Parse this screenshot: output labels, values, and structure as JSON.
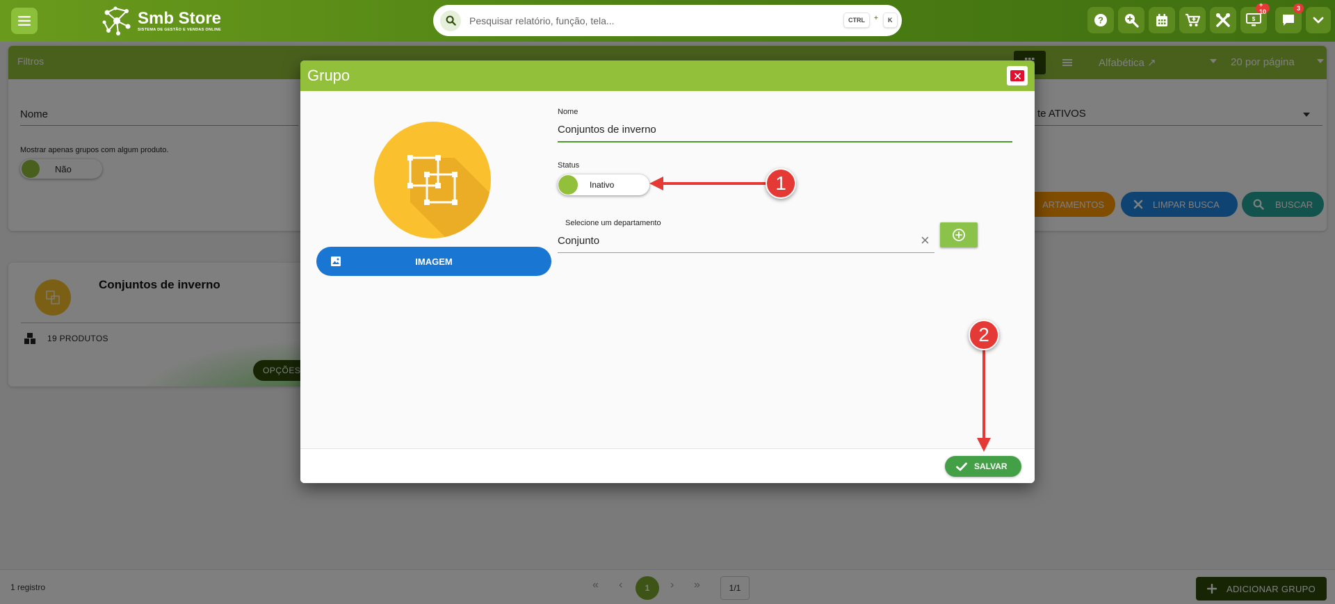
{
  "topbar": {
    "brand_title": "Smb Store",
    "brand_subtitle": "SISTEMA DE GESTÃO E VENDAS ONLINE",
    "search_placeholder": "Pesquisar relatório, função, tela...",
    "shortcut_ctrl": "CTRL",
    "shortcut_plus": "+",
    "shortcut_key": "K",
    "icons": [
      "help-icon",
      "zoom-icon",
      "calendar-icon",
      "cart-icon",
      "tools-icon",
      "monitor-icon",
      "chat-icon",
      "chevron-down-icon"
    ],
    "monitor_badge": "+ 10",
    "chat_badge": "3"
  },
  "filters": {
    "title": "Filtros",
    "sort_label": "Alfabética ↗",
    "per_page_label": "20 por página",
    "name_label": "Nome",
    "status_value": "te ATIVOS",
    "only_with_products_label": "Mostrar apenas grupos com algum produto.",
    "only_with_products_value": "Não",
    "btn_departments": "ARTAMENTOS",
    "btn_clear": "LIMPAR BUSCA",
    "btn_search": "BUSCAR"
  },
  "group_card": {
    "name": "Conjuntos de inverno",
    "product_count": "19 PRODUTOS",
    "options_label": "OPÇÕES"
  },
  "footer": {
    "record_count": "1 registro",
    "first": "«",
    "prev": "‹",
    "current_page": "1",
    "next": "›",
    "last": "»",
    "page_of": "1/1",
    "add_group_label": "ADICIONAR GRUPO"
  },
  "modal": {
    "title": "Grupo",
    "image_button_label": "IMAGEM",
    "name_label": "Nome",
    "name_value": "Conjuntos de inverno",
    "status_label": "Status",
    "status_value": "Inativo",
    "department_label": "Selecione um departamento",
    "department_value": "Conjunto",
    "save_label": "SALVAR"
  },
  "annotations": {
    "marker_1": "1",
    "marker_2": "2"
  },
  "colors": {
    "brand_green": "#93c03b",
    "topbar_dark_green": "#4d8014",
    "primary_blue": "#1976d2",
    "save_green": "#43a047",
    "close_red": "#e0102e",
    "image_yellow": "#fbc02d",
    "annotation_red": "#e53935"
  }
}
